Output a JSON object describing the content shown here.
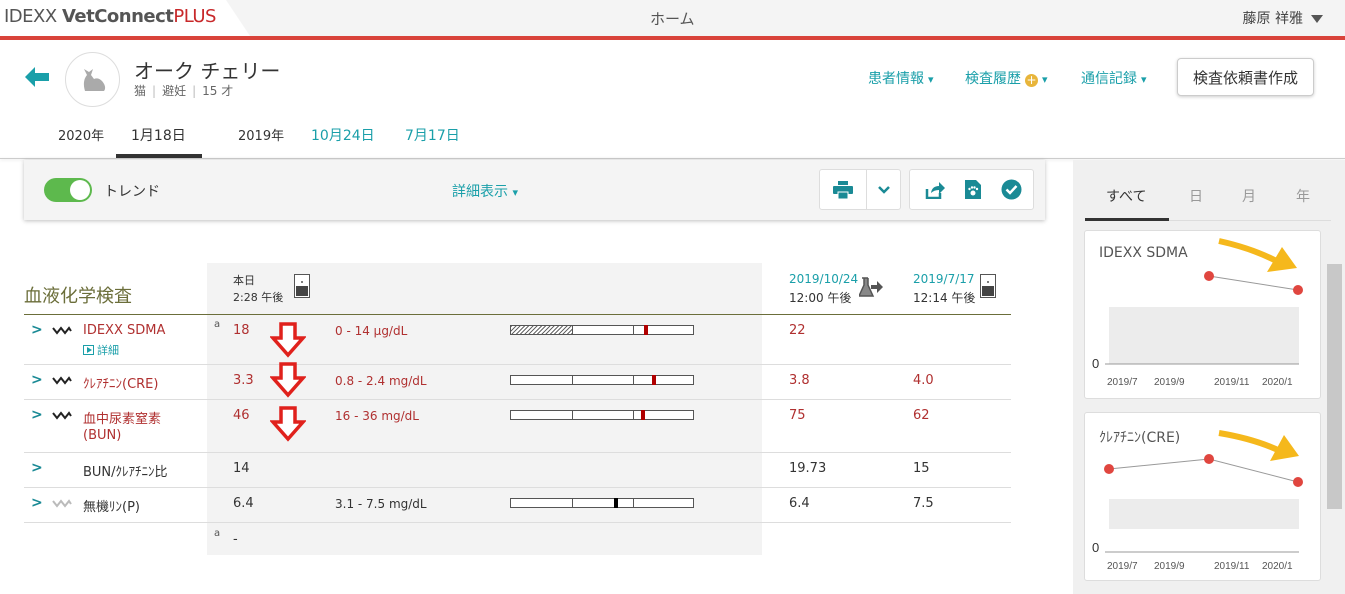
{
  "header": {
    "logo_idexx": "IDEXX ",
    "logo_vc": "VetConnect",
    "logo_plus": "PLUS",
    "home": "ホーム",
    "user": "藤原 祥雅"
  },
  "patient": {
    "name": "オーク チェリー",
    "species": "猫",
    "status": "避妊",
    "age": "15 才"
  },
  "nav": {
    "patient_info": "患者情報",
    "history": "検査履歴",
    "comms": "通信記録",
    "request_button": "検査依頼書作成"
  },
  "date_tabs": {
    "year_2020": "2020年",
    "jan18": "1月18日",
    "year_2019": "2019年",
    "oct24": "10月24日",
    "jul17": "7月17日"
  },
  "toolbar": {
    "trend_label": "トレンド",
    "detail_label": "詳細表示"
  },
  "panel": {
    "tabs": [
      "すべて",
      "日",
      "月",
      "年"
    ],
    "card1_title": "IDEXX SDMA",
    "card2_title": "ｸﾚｱﾁﾆﾝ(CRE)",
    "zero": "0",
    "x_ticks": [
      "2019/7",
      "2019/9",
      "2019/11",
      "2020/1"
    ]
  },
  "table": {
    "section_title": "血液化学検査",
    "col_today": "本日",
    "col_today_time": "2:28 午後",
    "col2_date": "2019/10/24",
    "col2_time": "12:00 午後",
    "col3_date": "2019/7/17",
    "col3_time": "12:14 午後",
    "footnote_a": "a",
    "footnote_dash": "-",
    "rows": [
      {
        "name": "IDEXX SDMA",
        "sub": "詳細",
        "flag": "a",
        "today": "18",
        "range": "0 - 14 µg/dL",
        "v2": "22",
        "v3": ""
      },
      {
        "name": "ｸﾚｱﾁﾆﾝ(CRE)",
        "today": "3.3",
        "range": "0.8 - 2.4 mg/dL",
        "v2": "3.8",
        "v3": "4.0"
      },
      {
        "name": "血中尿素窒素",
        "name2": "(BUN)",
        "today": "46",
        "range": "16 - 36 mg/dL",
        "v2": "75",
        "v3": "62"
      },
      {
        "name": "BUN/ｸﾚｱﾁﾆﾝ比",
        "today": "14",
        "range": "",
        "v2": "19.73",
        "v3": "15"
      },
      {
        "name": "無機ﾘﾝ(P)",
        "today": "6.4",
        "range": "3.1 - 7.5 mg/dL",
        "v2": "6.4",
        "v3": "7.5"
      }
    ]
  },
  "colors": {
    "accent": "#1a9fa9",
    "brand_red": "#d9433a",
    "abnormal": "#b03030",
    "toggle_on": "#5db94d"
  }
}
